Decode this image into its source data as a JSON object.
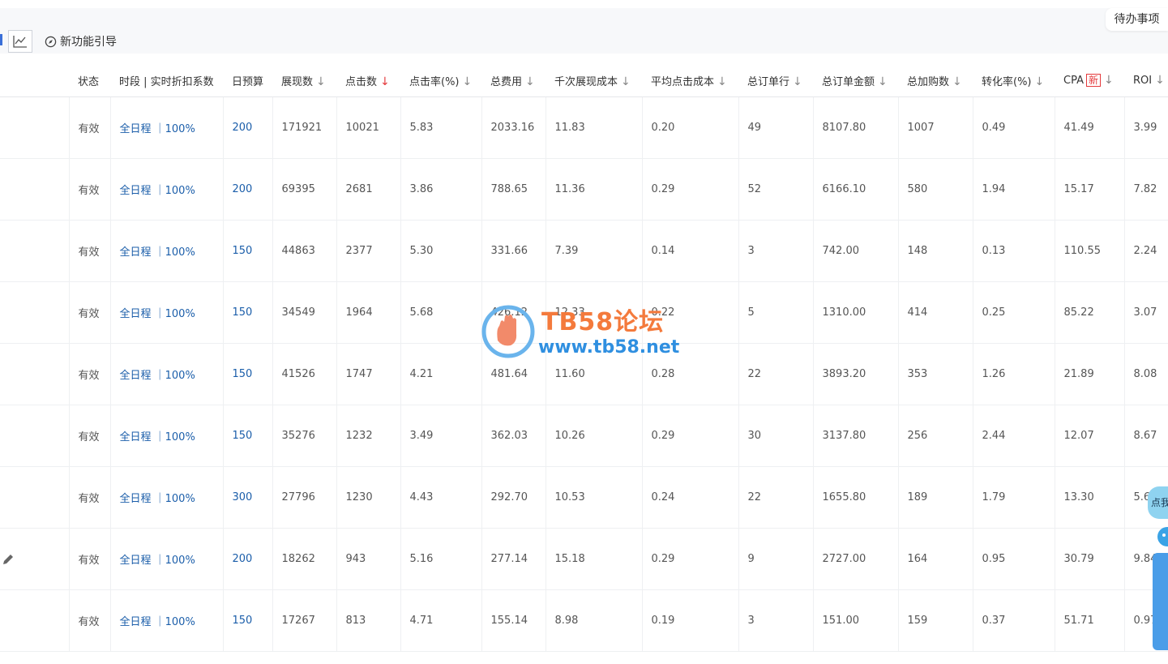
{
  "toolbar": {
    "chart_icon": "line-chart-icon",
    "guide_icon": "compass-icon",
    "guide_label": "新功能引导",
    "todo_label": "待办事项"
  },
  "table": {
    "columns": [
      {
        "key": "status",
        "label": "状态",
        "sort": false
      },
      {
        "key": "period",
        "label": "时段 | 实时折扣系数",
        "sort": false
      },
      {
        "key": "budget",
        "label": "日预算",
        "sort": false
      },
      {
        "key": "impressions",
        "label": "展现数",
        "sort": true
      },
      {
        "key": "clicks",
        "label": "点击数",
        "sort": true,
        "active": true
      },
      {
        "key": "ctr",
        "label": "点击率(%)",
        "sort": true
      },
      {
        "key": "cost",
        "label": "总费用",
        "sort": true
      },
      {
        "key": "cpm",
        "label": "千次展现成本",
        "sort": true
      },
      {
        "key": "cpc",
        "label": "平均点击成本",
        "sort": true
      },
      {
        "key": "orders",
        "label": "总订单行",
        "sort": true
      },
      {
        "key": "order_amount",
        "label": "总订单金额",
        "sort": true
      },
      {
        "key": "carts",
        "label": "总加购数",
        "sort": true
      },
      {
        "key": "cvr",
        "label": "转化率(%)",
        "sort": true
      },
      {
        "key": "cpa",
        "label": "CPA",
        "badge": "新",
        "sort": true
      },
      {
        "key": "roi",
        "label": "ROI",
        "sort": true
      }
    ],
    "sort_arrow": "↓",
    "rows": [
      {
        "status": "有效",
        "period": "全日程 ｜100%",
        "budget": "200",
        "impressions": "171921",
        "clicks": "10021",
        "ctr": "5.83",
        "cost": "2033.16",
        "cpm": "11.83",
        "cpc": "0.20",
        "orders": "49",
        "order_amount": "8107.80",
        "carts": "1007",
        "cvr": "0.49",
        "cpa": "41.49",
        "roi": "3.99"
      },
      {
        "status": "有效",
        "period": "全日程 ｜100%",
        "budget": "200",
        "impressions": "69395",
        "clicks": "2681",
        "ctr": "3.86",
        "cost": "788.65",
        "cpm": "11.36",
        "cpc": "0.29",
        "orders": "52",
        "order_amount": "6166.10",
        "carts": "580",
        "cvr": "1.94",
        "cpa": "15.17",
        "roi": "7.82"
      },
      {
        "status": "有效",
        "period": "全日程 ｜100%",
        "budget": "150",
        "impressions": "44863",
        "clicks": "2377",
        "ctr": "5.30",
        "cost": "331.66",
        "cpm": "7.39",
        "cpc": "0.14",
        "orders": "3",
        "order_amount": "742.00",
        "carts": "148",
        "cvr": "0.13",
        "cpa": "110.55",
        "roi": "2.24"
      },
      {
        "status": "有效",
        "period": "全日程 ｜100%",
        "budget": "150",
        "impressions": "34549",
        "clicks": "1964",
        "ctr": "5.68",
        "cost": "426.12",
        "cpm": "12.33",
        "cpc": "0.22",
        "orders": "5",
        "order_amount": "1310.00",
        "carts": "414",
        "cvr": "0.25",
        "cpa": "85.22",
        "roi": "3.07"
      },
      {
        "status": "有效",
        "period": "全日程 ｜100%",
        "budget": "150",
        "impressions": "41526",
        "clicks": "1747",
        "ctr": "4.21",
        "cost": "481.64",
        "cpm": "11.60",
        "cpc": "0.28",
        "orders": "22",
        "order_amount": "3893.20",
        "carts": "353",
        "cvr": "1.26",
        "cpa": "21.89",
        "roi": "8.08"
      },
      {
        "status": "有效",
        "period": "全日程 ｜100%",
        "budget": "150",
        "impressions": "35276",
        "clicks": "1232",
        "ctr": "3.49",
        "cost": "362.03",
        "cpm": "10.26",
        "cpc": "0.29",
        "orders": "30",
        "order_amount": "3137.80",
        "carts": "256",
        "cvr": "2.44",
        "cpa": "12.07",
        "roi": "8.67"
      },
      {
        "status": "有效",
        "period": "全日程 ｜100%",
        "budget": "300",
        "impressions": "27796",
        "clicks": "1230",
        "ctr": "4.43",
        "cost": "292.70",
        "cpm": "10.53",
        "cpc": "0.24",
        "orders": "22",
        "order_amount": "1655.80",
        "carts": "189",
        "cvr": "1.79",
        "cpa": "13.30",
        "roi": "5.6"
      },
      {
        "status": "有效",
        "period": "全日程 ｜100%",
        "budget": "200",
        "impressions": "18262",
        "clicks": "943",
        "ctr": "5.16",
        "cost": "277.14",
        "cpm": "15.18",
        "cpc": "0.29",
        "orders": "9",
        "order_amount": "2727.00",
        "carts": "164",
        "cvr": "0.95",
        "cpa": "30.79",
        "roi": "9.84",
        "edit": true
      },
      {
        "status": "有效",
        "period": "全日程 ｜100%",
        "budget": "150",
        "impressions": "17267",
        "clicks": "813",
        "ctr": "4.71",
        "cost": "155.14",
        "cpm": "8.98",
        "cpc": "0.19",
        "orders": "3",
        "order_amount": "151.00",
        "carts": "159",
        "cvr": "0.37",
        "cpa": "51.71",
        "roi": "0.97"
      }
    ]
  },
  "watermark": {
    "title": "TB58论坛",
    "url": "www.tb58.net"
  },
  "side_widget": {
    "bubble_text": "点我"
  },
  "colors": {
    "link": "#1b5eaa",
    "sort_active": "#e4393c",
    "sort_default": "#888888",
    "watermark_title": "#f47a3c",
    "watermark_url": "#2f8fe0"
  }
}
